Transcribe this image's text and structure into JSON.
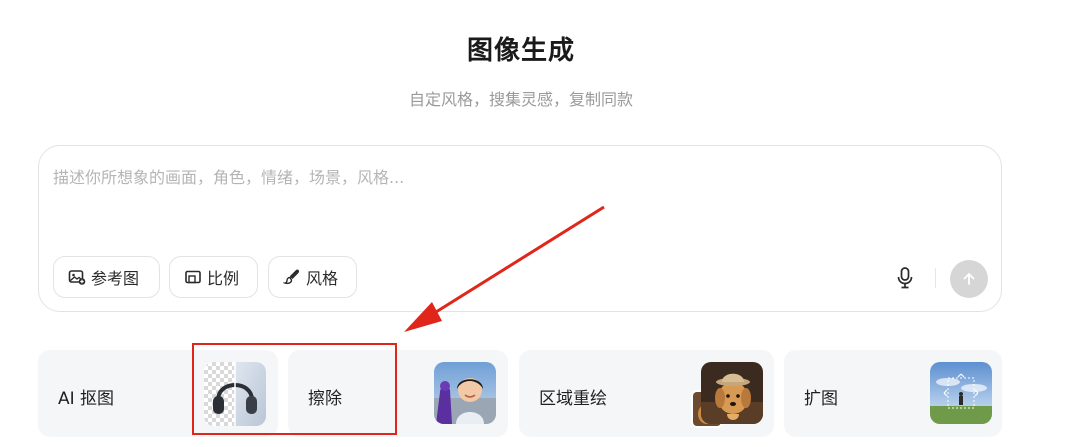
{
  "header": {
    "title": "图像生成",
    "subtitle": "自定风格，搜集灵感，复制同款"
  },
  "composer": {
    "placeholder": "描述你所想象的画面，角色，情绪，场景，风格...",
    "chips": {
      "reference": "参考图",
      "ratio": "比例",
      "style": "风格"
    }
  },
  "tools": [
    {
      "label": "AI 抠图",
      "icon": "headphones-cutout-thumbnail"
    },
    {
      "label": "擦除",
      "icon": "child-portrait-thumbnail"
    },
    {
      "label": "区域重绘",
      "icon": "dog-with-hat-thumbnail"
    },
    {
      "label": "扩图",
      "icon": "landscape-expand-thumbnail"
    }
  ],
  "colors": {
    "annotation_red": "#e0261b",
    "send_button_disabled": "#d6d6d6",
    "card_background": "#f5f6f8"
  }
}
